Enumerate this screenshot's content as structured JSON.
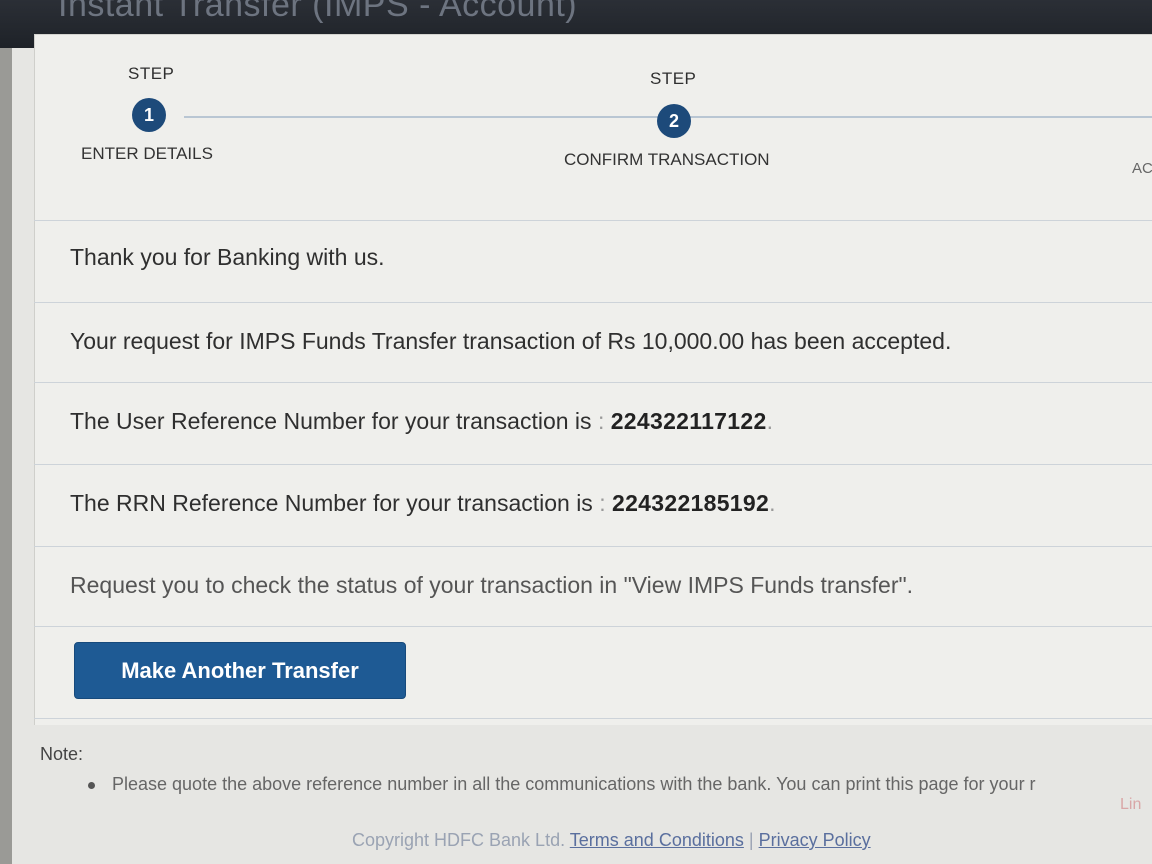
{
  "window": {
    "title": "Instant Transfer (IMPS - Account)"
  },
  "steps": [
    {
      "label": "STEP",
      "number": "1",
      "name": "ENTER DETAILS"
    },
    {
      "label": "STEP",
      "number": "2",
      "name": "CONFIRM TRANSACTION"
    },
    {
      "name_partial": "AC"
    }
  ],
  "messages": {
    "thanks": "Thank you for Banking with us.",
    "accepted": "Your request for IMPS Funds Transfer transaction of Rs 10,000.00 has been accepted.",
    "user_ref_label": "The User Reference Number for your transaction is",
    "user_ref_value": "224322117122",
    "rrn_label": "The RRN Reference Number for your transaction is",
    "rrn_value": "224322185192",
    "check_status": "Request you to check the status of your transaction in \"View IMPS Funds transfer\"."
  },
  "separator": ":",
  "period": ".",
  "button": {
    "make_another": "Make Another Transfer"
  },
  "note": {
    "label": "Note:",
    "item": "Please quote the above reference number in all the communications with the bank. You can print this page for your r"
  },
  "side_link_partial": "Lin",
  "footer": {
    "copyright": "Copyright HDFC Bank Ltd.",
    "terms": "Terms and Conditions",
    "pipe": "|",
    "privacy": "Privacy Policy"
  },
  "colors": {
    "accent": "#1e5a94",
    "step_circle": "#1d4a7a",
    "link": "#5a6f9e",
    "side_link": "#d9a7a7"
  }
}
